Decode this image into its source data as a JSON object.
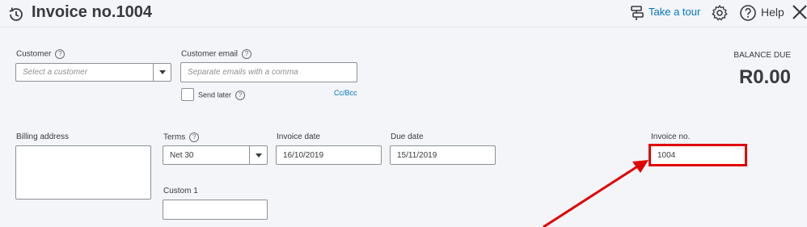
{
  "header": {
    "title": "Invoice no.1004",
    "take_tour": "Take a tour",
    "help": "Help"
  },
  "customer": {
    "label": "Customer",
    "placeholder": "Select a customer"
  },
  "customer_email": {
    "label": "Customer email",
    "placeholder": "Separate emails with a comma"
  },
  "send_later": {
    "label": "Send later"
  },
  "cc_bcc": "Cc/Bcc",
  "balance": {
    "label": "BALANCE DUE",
    "value": "R0.00"
  },
  "billing_address": {
    "label": "Billing address"
  },
  "terms": {
    "label": "Terms",
    "value": "Net 30"
  },
  "invoice_date": {
    "label": "Invoice date",
    "value": "16/10/2019"
  },
  "due_date": {
    "label": "Due date",
    "value": "15/11/2019"
  },
  "invoice_no": {
    "label": "Invoice no.",
    "value": "1004"
  },
  "custom1": {
    "label": "Custom 1"
  },
  "annotation": {
    "color": "#e00000"
  }
}
